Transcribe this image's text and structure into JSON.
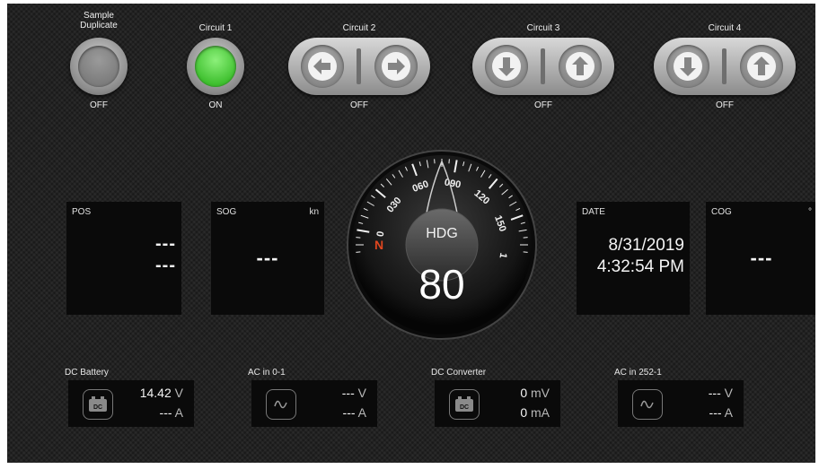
{
  "circuits": [
    {
      "label": "Sample Duplicate",
      "state": "OFF",
      "kind": "round",
      "on": false
    },
    {
      "label": "Circuit 1",
      "state": "ON",
      "kind": "round",
      "on": true
    },
    {
      "label": "Circuit 2",
      "state": "OFF",
      "kind": "rocker-lr"
    },
    {
      "label": "Circuit 3",
      "state": "OFF",
      "kind": "rocker-ud"
    },
    {
      "label": "Circuit 4",
      "state": "OFF",
      "kind": "rocker-ud"
    }
  ],
  "tiles": {
    "pos": {
      "title": "POS",
      "lat": "---",
      "lon": "---"
    },
    "sog": {
      "title": "SOG",
      "unit": "kn",
      "value": "---"
    },
    "date": {
      "title": "DATE",
      "date": "8/31/2019",
      "time": "4:32:54 PM"
    },
    "cog": {
      "title": "COG",
      "unit": "°",
      "value": "---"
    }
  },
  "heading": {
    "label": "HDG",
    "value": "80",
    "dial": [
      "0",
      "030",
      "060",
      "090",
      "120",
      "150",
      "1"
    ],
    "north": "N"
  },
  "power": [
    {
      "label": "DC Battery",
      "icon": "dc-battery-icon",
      "icon_text": "DC",
      "v": "14.42",
      "v_unit": "V",
      "a": "---",
      "a_unit": "A"
    },
    {
      "label": "AC in 0-1",
      "icon": "ac-sine-icon",
      "icon_text": "",
      "v": "---",
      "v_unit": "V",
      "a": "---",
      "a_unit": "A"
    },
    {
      "label": "DC Converter",
      "icon": "dc-battery-icon",
      "icon_text": "DC",
      "v": "0",
      "v_unit": "mV",
      "a": "0",
      "a_unit": "mA"
    },
    {
      "label": "AC in 252-1",
      "icon": "ac-sine-icon",
      "icon_text": "",
      "v": "---",
      "v_unit": "V",
      "a": "---",
      "a_unit": "A"
    }
  ],
  "colors": {
    "on": "#3fc02f",
    "north": "#e0461f",
    "background": "#222222"
  }
}
